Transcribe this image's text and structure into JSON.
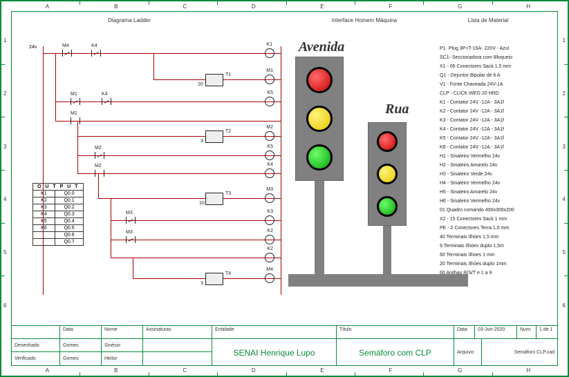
{
  "titles": {
    "ladder": "Diagrama Ladder",
    "hmi": "Interface Homem Máquina",
    "material": "Lista de Material"
  },
  "grid": {
    "cols": [
      "A",
      "B",
      "C",
      "D",
      "E",
      "F",
      "G",
      "H"
    ],
    "rows": [
      "1",
      "2",
      "3",
      "4",
      "5",
      "6"
    ]
  },
  "ladder": {
    "supply": "24v",
    "elements": {
      "m4": "M4",
      "k4a": "K4",
      "k1": "K1",
      "t1": "T1",
      "t1p": "20",
      "m1": "M1",
      "m1b": "M1",
      "k4b": "K4",
      "k5": "K5",
      "m1c": "M1",
      "t2": "T2",
      "t2p": "3",
      "m2": "M2",
      "m2a": "M2",
      "k5b": "K5",
      "m2b": "M2",
      "k4c": "K4",
      "t3": "T3",
      "t3p": "10",
      "m3": "M3",
      "m3a": "M3",
      "k3": "K3",
      "m3b": "M3",
      "k2": "K2",
      "t4": "T4",
      "t4p": "3",
      "m4o": "M4"
    }
  },
  "io_table": {
    "header": "O U T P U T",
    "rows": [
      [
        "K1",
        "Q0.0"
      ],
      [
        "K2",
        "Q0.1"
      ],
      [
        "K3",
        "Q0.2"
      ],
      [
        "K4",
        "Q0.3"
      ],
      [
        "K5",
        "Q0.4"
      ],
      [
        "K6",
        "Q0.5"
      ],
      [
        "",
        "Q0.6"
      ],
      [
        "",
        "Q0.7"
      ]
    ]
  },
  "hmi": {
    "avenida": "Avenida",
    "rua": "Rua"
  },
  "materials": [
    "P1- Plug 3P+T-16A- 220V - Azul",
    "SC1- Seccionadora com Bloqueio",
    "X1 - 06 Conectores Sack 1,5 mm",
    "Q1 - Dejuntor Bipolar de 6 A",
    "V1 - Fonte Chaveada 24V-1A",
    "CLP - CLICK WEG 20 HRD",
    "K1 - Contator 24V -12A - 3A1f",
    "K2 - Contator 24V -12A - 3A1f",
    "K3 - Contator 24V -12A - 3A1f",
    "K4 - Contator 24V -12A - 3A1f",
    "K5 - Contator 24V -12A - 3A1f",
    "K6 - Contator 24V -12A - 3A1f",
    "H1 - Sinaleiro Vermelho 24v",
    "H2 - Sinaleiro Amarelo 24v",
    "H3 - Sinaleiro Verde 24v",
    "H4 - Sinaleiro Vermelho 24v",
    "H5 - Sinaleiro Amarelo 24v",
    "H6 - Sinaleiro Vermelho 24v",
    "01 Quadro comando 400x300x200",
    "X2 - 15 Conectores Sack 1 mm",
    "PE - 2 Conectores Terra 1,5 mm",
    "40 Terminais Ilhóes 1,5 mm",
    "9 Terminais Ilhóes duplo 1,5m",
    "60 Terminais Ilhoes 1 mm",
    "20 Terminais Ilhóes duplo 1mm",
    "60 Anilhas R/S/T e 1 a 9"
  ],
  "titleblock": {
    "labels": {
      "data": "Data",
      "nome": "Nome",
      "assin": "Assinaturas",
      "desenhado": "Desenhado",
      "verificado": "Verificado",
      "entidade": "Entidade",
      "titulo": "Título",
      "data2": "Data",
      "num": "Num:",
      "arquivo": "Arquivo:"
    },
    "values": {
      "des_data": "Gomes",
      "des_nome": "Sinésio",
      "ver_data": "Gomes",
      "ver_nome": "Heitor",
      "entidade": "SENAI Henrique Lupo",
      "titulo": "Semáforo com CLP",
      "data2": "03-Jun-2020",
      "num": "1 de 1",
      "arquivo": "Semáforo CLP.cad"
    }
  }
}
